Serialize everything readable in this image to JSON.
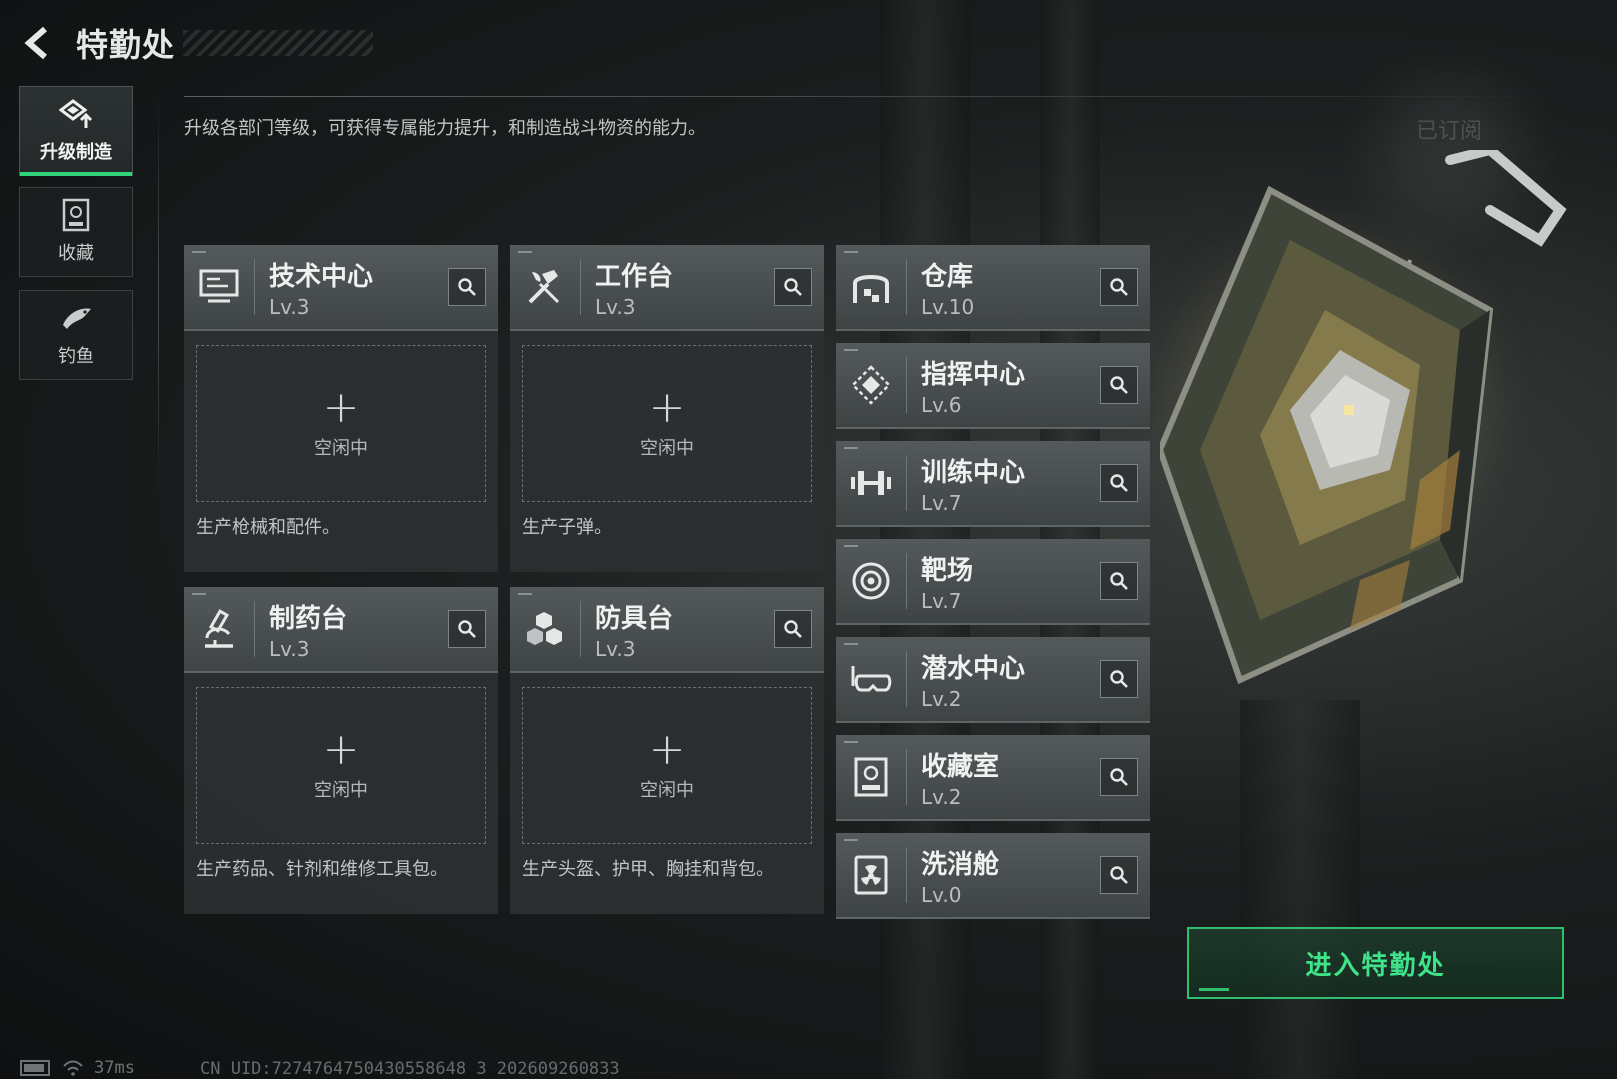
{
  "header": {
    "title": "特勤处"
  },
  "sidebar": {
    "items": [
      {
        "label": "升级制造",
        "icon": "upgrade-icon",
        "active": true
      },
      {
        "label": "收藏",
        "icon": "collection-icon",
        "active": false
      },
      {
        "label": "钓鱼",
        "icon": "fish-icon",
        "active": false
      }
    ]
  },
  "main": {
    "description": "升级各部门等级，可获得专属能力提升，和制造战斗物资的能力。",
    "subscribed_label": "已订阅",
    "production_cards": [
      {
        "name": "技术中心",
        "level": "Lv.3",
        "icon": "computer-icon",
        "slot_status": "空闲中",
        "description": "生产枪械和配件。"
      },
      {
        "name": "工作台",
        "level": "Lv.3",
        "icon": "tools-icon",
        "slot_status": "空闲中",
        "description": "生产子弹。"
      },
      {
        "name": "制药台",
        "level": "Lv.3",
        "icon": "microscope-icon",
        "slot_status": "空闲中",
        "description": "生产药品、针剂和维修工具包。"
      },
      {
        "name": "防具台",
        "level": "Lv.3",
        "icon": "armor-blocks-icon",
        "slot_status": "空闲中",
        "description": "生产头盔、护甲、胸挂和背包。"
      }
    ],
    "facilities": [
      {
        "name": "仓库",
        "level": "Lv.10",
        "icon": "warehouse-icon"
      },
      {
        "name": "指挥中心",
        "level": "Lv.6",
        "icon": "command-chip-icon"
      },
      {
        "name": "训练中心",
        "level": "Lv.7",
        "icon": "dumbbell-icon"
      },
      {
        "name": "靶场",
        "level": "Lv.7",
        "icon": "target-icon"
      },
      {
        "name": "潜水中心",
        "level": "Lv.2",
        "icon": "diving-mask-icon"
      },
      {
        "name": "收藏室",
        "level": "Lv.2",
        "icon": "collection-room-icon"
      },
      {
        "name": "洗消舱",
        "level": "Lv.0",
        "icon": "radiation-icon"
      }
    ],
    "plus_symbol": "+"
  },
  "enter_button": {
    "label": "进入特勤处"
  },
  "status_bar": {
    "ping": "37ms",
    "uid": "CN UID:7274764750430558648 3 202609260833"
  },
  "colors": {
    "accent": "#2fd37b",
    "button_text": "#3fe38a"
  }
}
